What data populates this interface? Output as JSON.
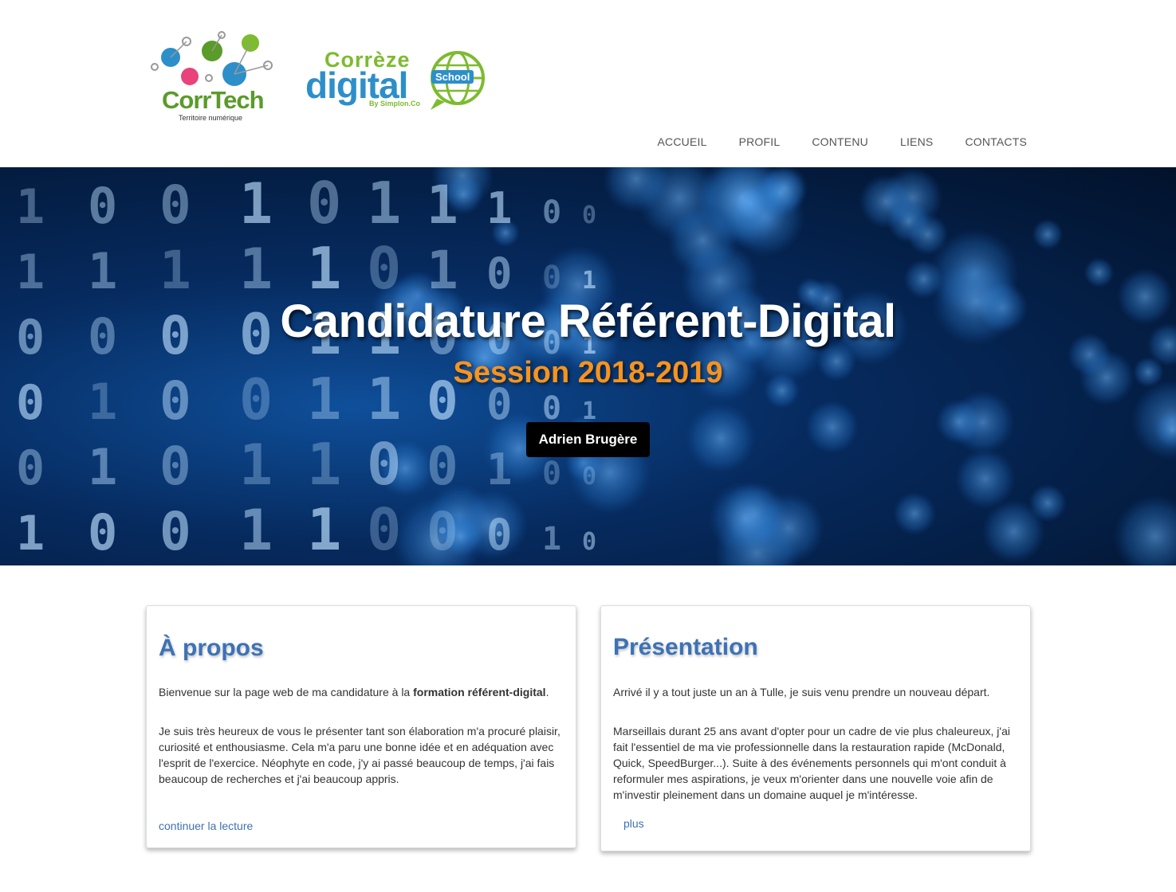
{
  "header": {
    "corrtech": {
      "brand": "CorrTech",
      "tagline": "Territoire numérique"
    },
    "correze": {
      "top": "Corrèze",
      "main": "digital",
      "badge": "School",
      "by": "By Simplon.Co"
    },
    "nav": [
      "ACCUEIL",
      "PROFIL",
      "CONTENU",
      "LIENS",
      "CONTACTS"
    ]
  },
  "hero": {
    "title": "Candidature Référent-Digital",
    "subtitle": "Session 2018-2019",
    "button": "Adrien Brugère"
  },
  "about": {
    "title": "À propos",
    "p1_before": "Bienvenue sur la page web de ma candidature à la ",
    "p1_strong": "formation référent-digital",
    "p1_after": ".",
    "p2": "Je suis très heureux de vous le présenter tant son élaboration m'a procuré plaisir, curiosité et enthousiasme. Cela m'a paru une bonne idée et en adéquation avec l'esprit de l'exercice. Néophyte en code, j'y ai passé beaucoup de temps, j'ai fais beaucoup de recherches et j'ai beaucoup appris.",
    "link": "continuer la lecture"
  },
  "presentation": {
    "title": "Présentation",
    "p1": "Arrivé il y a tout juste un an à Tulle, je suis venu prendre un nouveau départ.",
    "p2": "Marseillais durant 25 ans avant d'opter pour un cadre de vie plus chaleureux, j'ai fait l'essentiel de ma vie professionnelle dans la restauration rapide (McDonald, Quick, SpeedBurger...). Suite à des événements personnels qui m'ont conduit à reformuler mes aspirations, je veux m'orienter dans une nouvelle voie afin de m'investir pleinement dans un domaine auquel je m'intéresse.",
    "link": "plus"
  },
  "colors": {
    "accent": "#3d72b5",
    "orange": "#f7931e",
    "green": "#7dbb2f",
    "blue": "#2d8fc9"
  }
}
